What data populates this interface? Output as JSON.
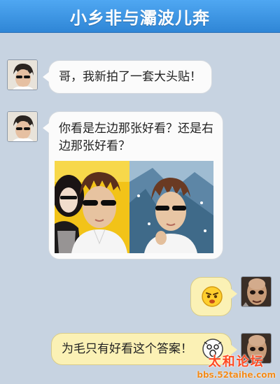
{
  "header": {
    "title": "小乡非与灞波儿奔"
  },
  "messages": [
    {
      "side": "left",
      "text": "哥，我新拍了一套大头贴！"
    },
    {
      "side": "left",
      "text": "你看是左边那张好看？还是右边那张好看？"
    },
    {
      "side": "right",
      "icon": "angry-face-emoji"
    },
    {
      "side": "right",
      "text": "为毛只有好看这个答案！"
    }
  ],
  "watermark": {
    "name": "太和论坛",
    "url": "bbs.52taihe.com"
  },
  "colors": {
    "titlebar": "#3a94e2",
    "chat_bg": "#c7d3e1",
    "left_bubble": "#fbfbfb",
    "right_bubble": "#fbf1b5",
    "watermark": "#ff4a22"
  }
}
